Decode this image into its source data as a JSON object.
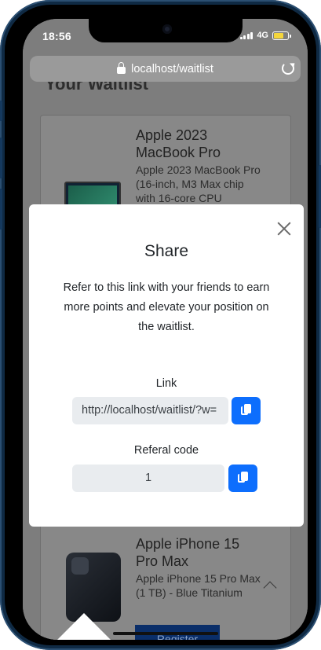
{
  "status_bar": {
    "time": "18:56",
    "network": "4G"
  },
  "browser": {
    "url": "localhost/waitlist"
  },
  "page": {
    "heading": "Your Waitlist",
    "cards": [
      {
        "title": "Apple 2023 MacBook Pro",
        "description": "Apple 2023 MacBook Pro (16-inch, M3 Max chip with 16-core CPU"
      },
      {
        "title": "Apple iPhone 15 Pro Max",
        "description": "Apple iPhone 15 Pro Max (1 TB) - Blue Titanium",
        "button": "Register"
      }
    ]
  },
  "modal": {
    "title": "Share",
    "text": "Refer to this link with your friends to earn more points and elevate your position on the waitlist.",
    "link_label": "Link",
    "link_value": "http://localhost/waitlist/?w=",
    "code_label": "Referal code",
    "code_value": "1"
  },
  "colors": {
    "primary": "#0d6efd",
    "overlay": "#808080",
    "frame": "#0f2a44"
  }
}
